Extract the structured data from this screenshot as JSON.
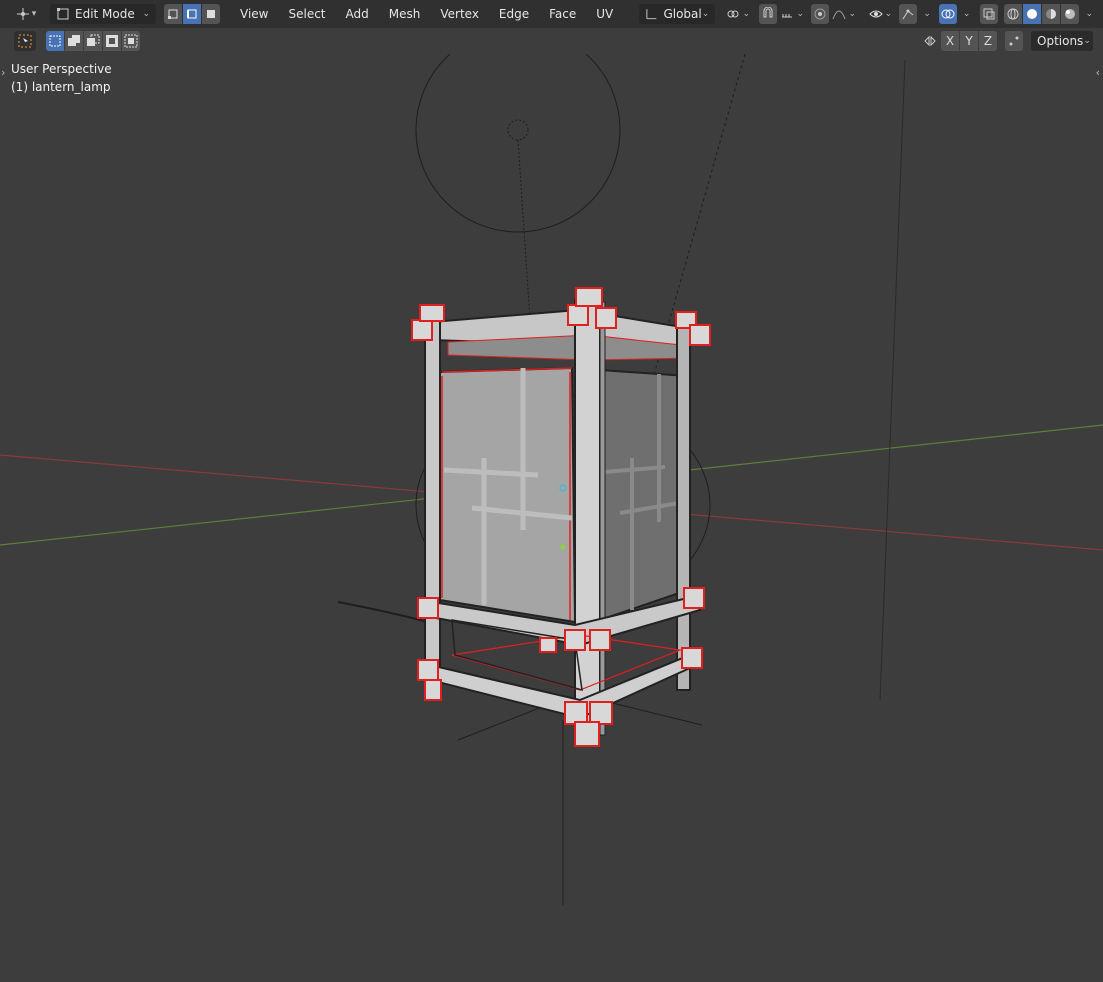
{
  "header": {
    "mode": "Edit Mode",
    "menus": [
      "View",
      "Select",
      "Add",
      "Mesh",
      "Vertex",
      "Edge",
      "Face",
      "UV"
    ],
    "transform_orientation": "Global",
    "options_label": "Options",
    "axes": [
      "X",
      "Y",
      "Z"
    ]
  },
  "viewport": {
    "perspective_label": "User Perspective",
    "object_label": "(1) lantern_lamp"
  },
  "colors": {
    "header_bg": "#303030",
    "viewport_bg": "#3d3d3d",
    "active_blue": "#4772b3",
    "selection_red": "#e0201f",
    "x_axis": "#b34545",
    "y_axis": "#6f9a3f"
  }
}
